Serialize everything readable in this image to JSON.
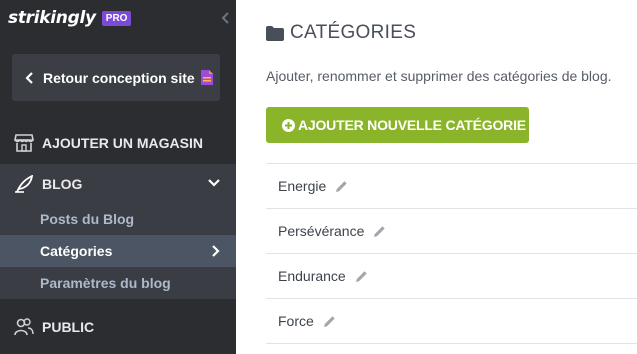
{
  "brand": {
    "logo_text": "strikingly",
    "badge": "PRO"
  },
  "sidebar": {
    "back_label": "Retour conception site",
    "store_label": "AJOUTER UN MAGASIN",
    "blog_label": "BLOG",
    "blog_items": [
      {
        "label": "Posts du Blog"
      },
      {
        "label": "Catégories"
      },
      {
        "label": "Paramètres du blog"
      }
    ],
    "public_label": "PUBLIC"
  },
  "main": {
    "title": "CATÉGORIES",
    "description": "Ajouter, renommer et supprimer des catégories de blog.",
    "add_button_label": "AJOUTER NOUVELLE CATÉGORIE",
    "categories": [
      {
        "name": "Energie"
      },
      {
        "name": "Persévérance"
      },
      {
        "name": "Endurance"
      },
      {
        "name": "Force"
      }
    ]
  },
  "colors": {
    "sidebar_bg": "#2b2d31",
    "active_item_bg": "#4c5563",
    "add_button": "#8ab52b",
    "pro_badge": "#7b4bd6"
  },
  "icons": [
    "chevron-left-icon",
    "document-icon",
    "store-icon",
    "feather-icon",
    "chevron-down-icon",
    "chevron-right-icon",
    "users-icon",
    "folder-icon",
    "plus-circle-icon",
    "pencil-icon"
  ]
}
